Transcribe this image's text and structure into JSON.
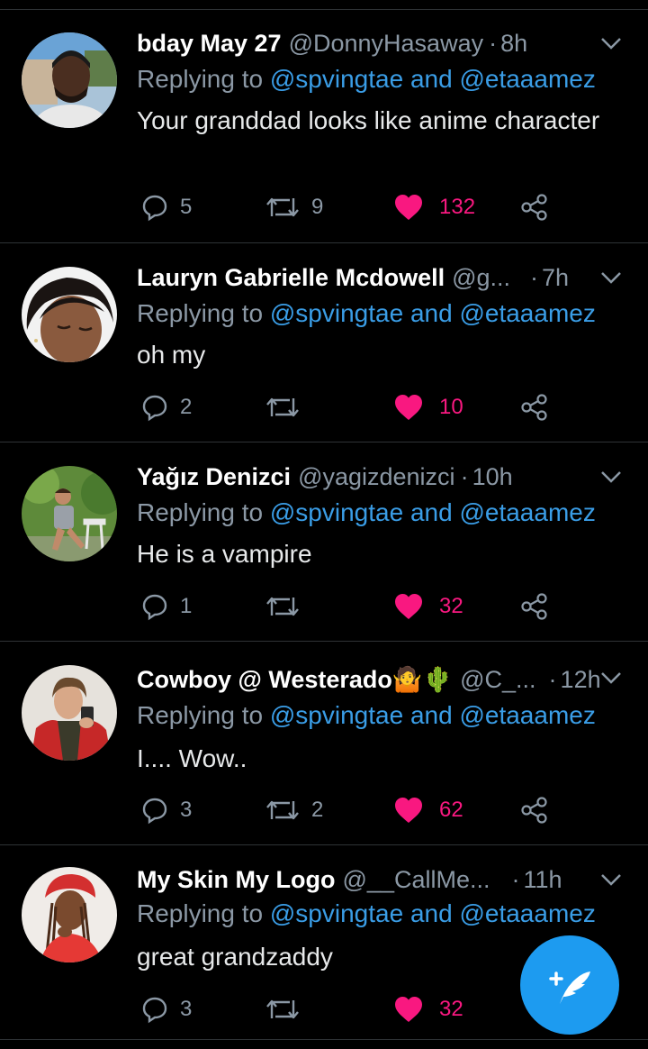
{
  "colors": {
    "background": "#000000",
    "accent": "#1d9bf0",
    "mention": "#3a9de6",
    "like": "#f91880",
    "muted": "#8b98a5"
  },
  "tweets": [
    {
      "name": "bday May 27",
      "handle": "@DonnyHasaway",
      "dot": "·",
      "time": "8h",
      "replying_prefix": "Replying to",
      "mention1": "@spvingtae",
      "and": "and",
      "mention2": "@etaaamez",
      "text": "Your granddad looks like anime character",
      "replies": "5",
      "retweets": "9",
      "likes": "132",
      "liked": true
    },
    {
      "name": "Lauryn Gabrielle Mcdowell",
      "handle": "@g...",
      "dot": "·",
      "time": "7h",
      "replying_prefix": "Replying to",
      "mention1": "@spvingtae",
      "and": "and",
      "mention2": "@etaaamez",
      "text": "oh my",
      "replies": "2",
      "retweets": "",
      "likes": "10",
      "liked": true
    },
    {
      "name": "Yağız Denizci",
      "handle": "@yagizdenizci",
      "dot": "·",
      "time": "10h",
      "replying_prefix": "Replying to",
      "mention1": "@spvingtae",
      "and": "and",
      "mention2": "@etaaamez",
      "text": "He is a vampire",
      "replies": "1",
      "retweets": "",
      "likes": "32",
      "liked": true
    },
    {
      "name": "Cowboy @ Westerado🤷🌵",
      "handle": "@C_...",
      "dot": "·",
      "time": "12h",
      "replying_prefix": "Replying to",
      "mention1": "@spvingtae",
      "and": "and",
      "mention2": "@etaaamez",
      "text": "I.... Wow..",
      "replies": "3",
      "retweets": "2",
      "likes": "62",
      "liked": true
    },
    {
      "name": "My Skin My Logo",
      "handle": "@__CallMe...",
      "dot": "·",
      "time": "11h",
      "replying_prefix": "Replying to",
      "mention1": "@spvingtae",
      "and": "and",
      "mention2": "@etaaamez",
      "text": "great grandzaddy",
      "replies": "3",
      "retweets": "",
      "likes": "32",
      "liked": true
    }
  ],
  "compose": {
    "icon": "compose-feather-icon"
  }
}
